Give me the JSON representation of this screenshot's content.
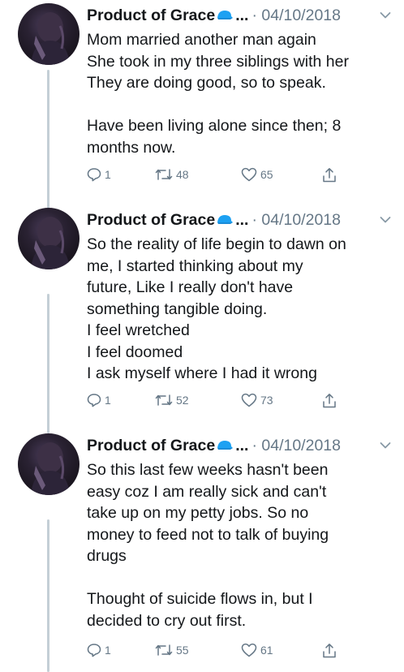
{
  "colors": {
    "text": "#14171a",
    "muted": "#657786",
    "thread_line": "#c4cfd6",
    "verified": "#1da1f2"
  },
  "tweets": [
    {
      "author": "Product of Grace",
      "ellipsis": "...",
      "date": "· 04/10/2018",
      "lines": [
        "Mom married another man again",
        "She took in my three siblings with her",
        "They are doing good, so to speak.",
        "",
        "Have been living alone since then; 8",
        "months now."
      ],
      "replies": "1",
      "retweets": "48",
      "likes": "65"
    },
    {
      "author": "Product of Grace",
      "ellipsis": "...",
      "date": "· 04/10/2018",
      "lines": [
        "So the reality of life begin to dawn on",
        "me,  I started thinking about my",
        "future,  Like I really don't have",
        "something tangible doing.",
        "I feel wretched",
        "I feel doomed",
        "I ask myself where I had it wrong"
      ],
      "replies": "1",
      "retweets": "52",
      "likes": "73"
    },
    {
      "author": "Product of Grace",
      "ellipsis": "...",
      "date": "· 04/10/2018",
      "lines": [
        "So this last few weeks hasn't been",
        "easy coz I am really sick and can't",
        "take up on my petty jobs.  So no",
        "money to feed not to talk of buying",
        "drugs",
        "",
        "Thought of suicide flows in,  but I",
        "decided to cry out first."
      ],
      "replies": "1",
      "retweets": "55",
      "likes": "61"
    }
  ]
}
